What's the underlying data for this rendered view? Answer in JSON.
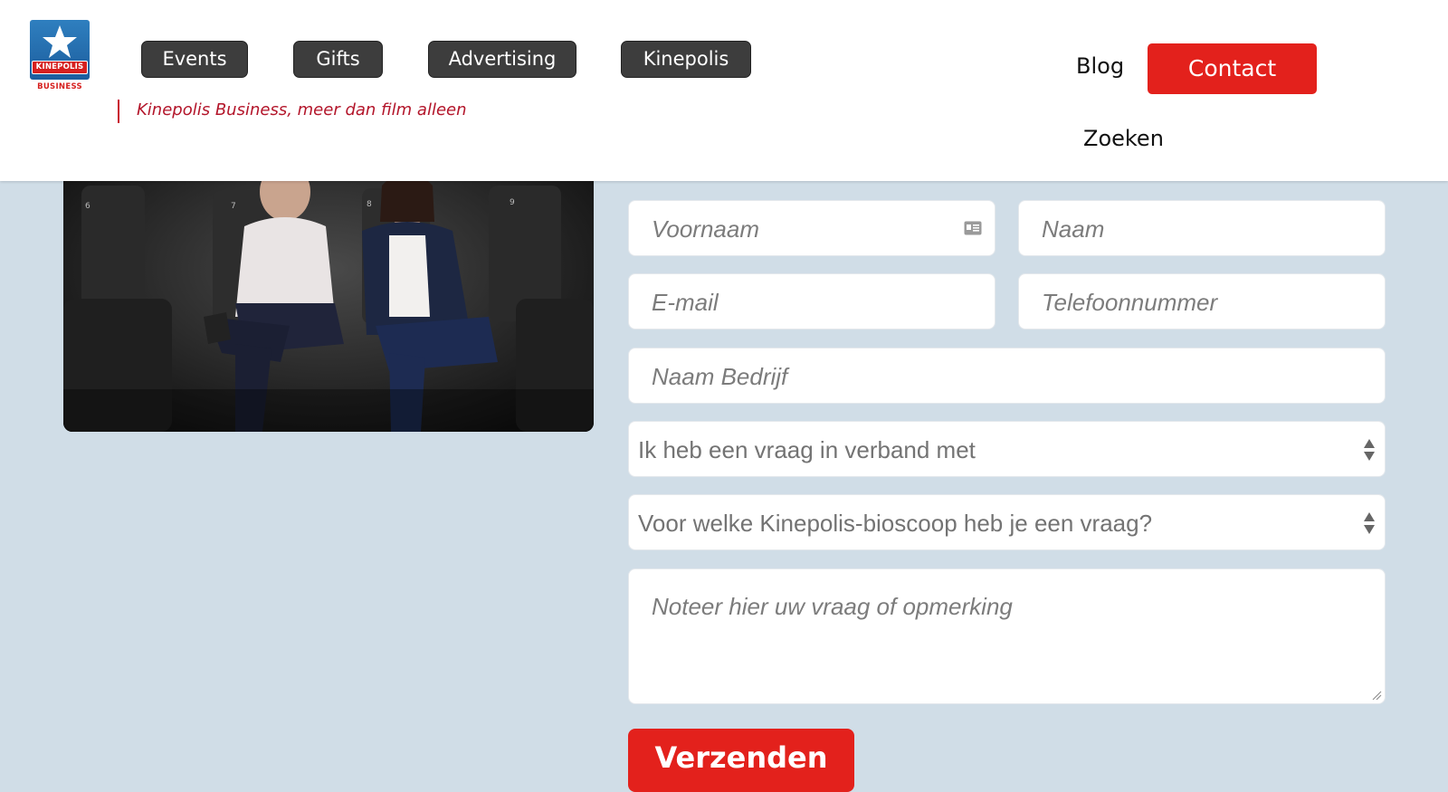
{
  "brand": {
    "logo_band": "KINEPOLIS",
    "logo_sub": "BUSINESS",
    "tagline": "Kinepolis Business, meer dan film alleen",
    "accent": "#e3211c",
    "nav_dark": "#3d3d3d"
  },
  "nav": {
    "items": [
      {
        "label": "Events"
      },
      {
        "label": "Gifts"
      },
      {
        "label": "Advertising"
      },
      {
        "label": "Kinepolis"
      }
    ],
    "blog": "Blog",
    "contact": "Contact",
    "search": "Zoeken"
  },
  "photo": {
    "seat_numbers": [
      "6",
      "7",
      "8",
      "9"
    ]
  },
  "form": {
    "first_name": {
      "placeholder": "Voornaam"
    },
    "last_name": {
      "placeholder": "Naam"
    },
    "email": {
      "placeholder": "E-mail"
    },
    "phone": {
      "placeholder": "Telefoonnummer"
    },
    "company": {
      "placeholder": "Naam Bedrijf"
    },
    "topic": {
      "selected": "Ik heb een vraag in verband met"
    },
    "cinema": {
      "selected": "Voor welke Kinepolis-bioscoop heb je een vraag?"
    },
    "message": {
      "placeholder": "Noteer hier uw vraag of opmerking"
    },
    "submit": "Verzenden"
  }
}
